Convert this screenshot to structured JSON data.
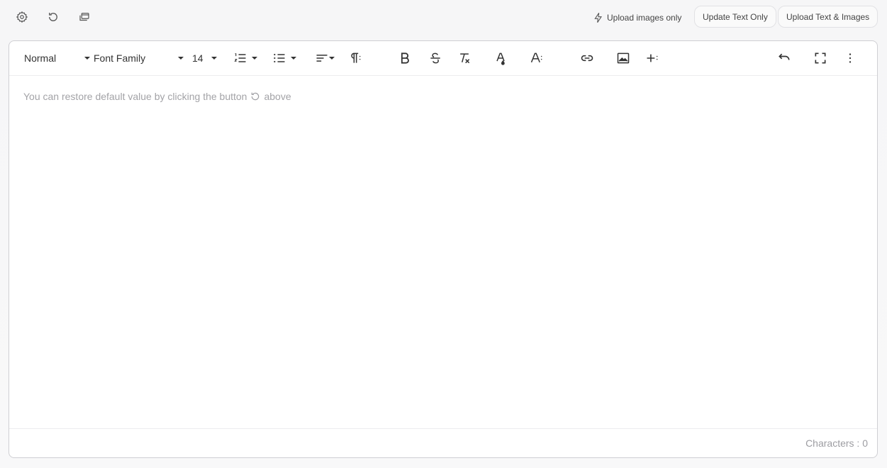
{
  "top_bar": {
    "icons": [
      "settings-icon",
      "reset-icon",
      "copy-window-icon"
    ],
    "upload_images_label": "Upload images only",
    "update_text_label": "Update Text Only",
    "upload_text_images_label": "Upload Text & Images"
  },
  "toolbar": {
    "paragraph_style": "Normal",
    "font_family": "Font Family",
    "font_size": "14",
    "icons": [
      "ordered-list-icon",
      "unordered-list-icon",
      "align-icon",
      "paragraph-format-icon",
      "bold-icon",
      "strikethrough-icon",
      "clear-formatting-icon",
      "text-color-icon",
      "more-text-icon",
      "link-icon",
      "image-icon",
      "insert-more-icon",
      "undo-icon",
      "fullscreen-icon",
      "more-options-icon"
    ]
  },
  "editor": {
    "placeholder_before": "You can restore default value by clicking the button",
    "placeholder_after": "above"
  },
  "footer": {
    "characters_label": "Characters : ",
    "characters_count": "0"
  },
  "colors": {
    "page_bg": "#f7f7f8",
    "border": "#cfcfd3",
    "placeholder": "#a3a3a7",
    "text": "#333333"
  }
}
